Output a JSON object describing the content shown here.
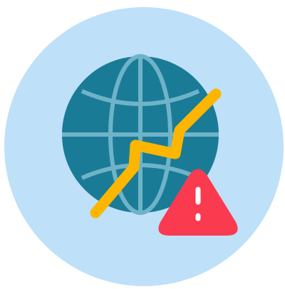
{
  "icon": {
    "name": "global-market-crash-warning-icon",
    "parts": [
      "background-circle",
      "globe-icon",
      "zigzag-trend-line",
      "warning-triangle-icon"
    ]
  },
  "colors": {
    "background_circle": "#BEE0F8",
    "globe_fill": "#1A7B96",
    "globe_lines": "#6FB3C8",
    "trend_line": "#FCB600",
    "warning_fill": "#FA3A4E",
    "warning_mark": "#FFFFFF"
  }
}
